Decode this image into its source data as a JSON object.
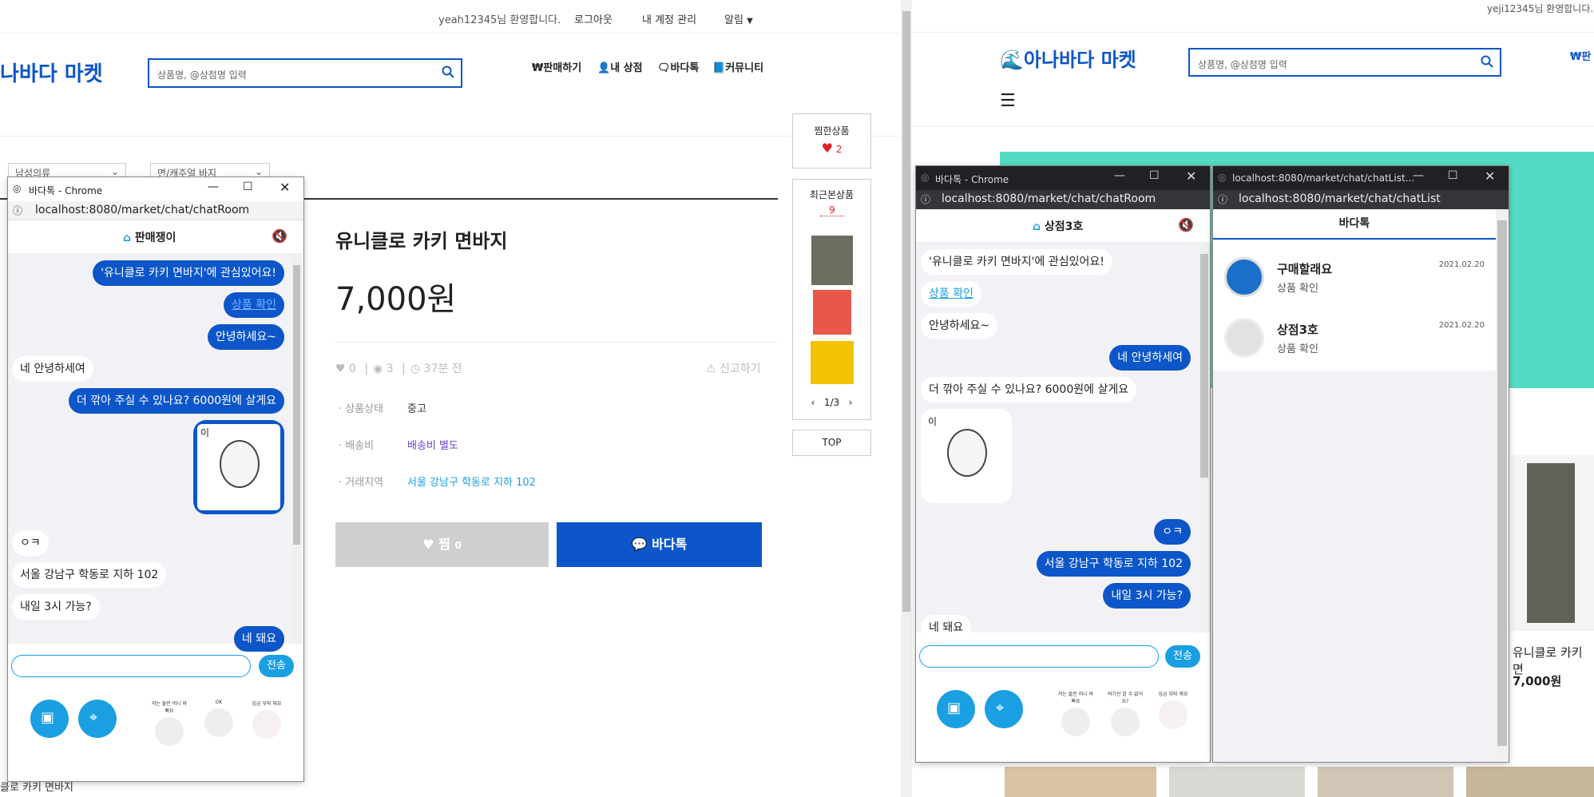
{
  "left_page": {
    "welcome": "yeah12345님 환영합니다.",
    "logout": "로그아웃",
    "account": "내 계정 관리",
    "notify": "알림",
    "logo": "나바다 마켓",
    "search_placeholder": "상품명, @상점명 입력",
    "nav": [
      "₩판매하기",
      "내 상점",
      "바다톡",
      "커뮤니티"
    ],
    "category1": "남성의류",
    "category2": "면/캐주얼 바지",
    "product": {
      "title": "유니클로 카키 면바지",
      "price": "7,000원",
      "likes": "0",
      "views": "3",
      "time": "37분 전",
      "report": "신고하기",
      "condition_label": "상품상태",
      "condition": "중고",
      "shipping_label": "배송비",
      "shipping": "배송비 별도",
      "location_label": "거래지역",
      "location": "서울 강남구 학동로 지하 102",
      "like_button": "찜",
      "like_count": "0",
      "chat_button": "바다톡"
    },
    "side": {
      "wish_title": "찜한상품",
      "wish_count": "2",
      "recent_title": "최근본상품",
      "recent_count": "9",
      "pager": "1/3",
      "top": "TOP"
    },
    "bottom_caption": "클로 카키 면바지"
  },
  "chat_left": {
    "window_title": "바다톡 - Chrome",
    "url": "localhost:8080/market/chat/chatRoom",
    "partner": "판매쟁이",
    "messages": [
      {
        "side": "me",
        "text": "'유니클로 카키 면바지'에 관심있어요!"
      },
      {
        "side": "me",
        "text": "상품 확인"
      },
      {
        "side": "me",
        "text": "안녕하세요~"
      },
      {
        "side": "you",
        "text": "네 안녕하세여"
      },
      {
        "side": "me",
        "text": "더 깎아 주실 수 있나요? 6000원에 살게요"
      },
      {
        "side": "me",
        "text": "이"
      },
      {
        "side": "you",
        "text": "ㅇㅋ"
      },
      {
        "side": "you",
        "text": "서울 강남구 학동로 지하 102"
      },
      {
        "side": "you",
        "text": "내일 3시 가능?"
      },
      {
        "side": "me",
        "text": "네 돼요"
      }
    ],
    "send": "전송",
    "stickers": [
      "저는 돌린 머니 바빠요",
      "OK",
      "입금 부탁 해요"
    ]
  },
  "right_page": {
    "welcome": "yeji12345님 환영합니다.",
    "logo": "아나바다 마켓",
    "search_placeholder": "상품명, @상점명 입력",
    "nav_partial": "₩판",
    "product_title": "유니클로 카키 면",
    "product_price": "7,000원"
  },
  "chat_room2": {
    "window_title": "바다톡 - Chrome",
    "url": "localhost:8080/market/chat/chatRoom",
    "partner": "상점3호",
    "messages": [
      {
        "side": "you",
        "text": "'유니클로 카키 면바지'에 관심있어요!"
      },
      {
        "side": "you",
        "text": "상품 확인"
      },
      {
        "side": "you",
        "text": "안녕하세요~"
      },
      {
        "side": "me",
        "text": "네 안녕하세여"
      },
      {
        "side": "you",
        "text": "더 깎아 주실 수 있나요? 6000원에 살게요"
      },
      {
        "side": "you",
        "text": "이"
      },
      {
        "side": "me",
        "text": "ㅇㅋ"
      },
      {
        "side": "me",
        "text": "서울 강남구 학동로 지하 102"
      },
      {
        "side": "me",
        "text": "내일 3시 가능?"
      },
      {
        "side": "you",
        "text": "네 돼요"
      }
    ],
    "send": "전송",
    "stickers": [
      "저는 돌린 머니 바빠요",
      "여기선 잘 수 없어요?",
      "입금 부탁 해요"
    ]
  },
  "chat_list": {
    "window_title": "localhost:8080/market/chat/chatList...",
    "url": "localhost:8080/market/chat/chatList",
    "header": "바다톡",
    "rooms": [
      {
        "name": "구매할래요",
        "sub": "상품 확인",
        "date": "2021.02.20"
      },
      {
        "name": "상점3호",
        "sub": "상품 확인",
        "date": "2021.02.20"
      }
    ]
  },
  "colors": {
    "brand": "#0c56c9",
    "accent": "#1b9fe3",
    "heart": "#e02020"
  }
}
